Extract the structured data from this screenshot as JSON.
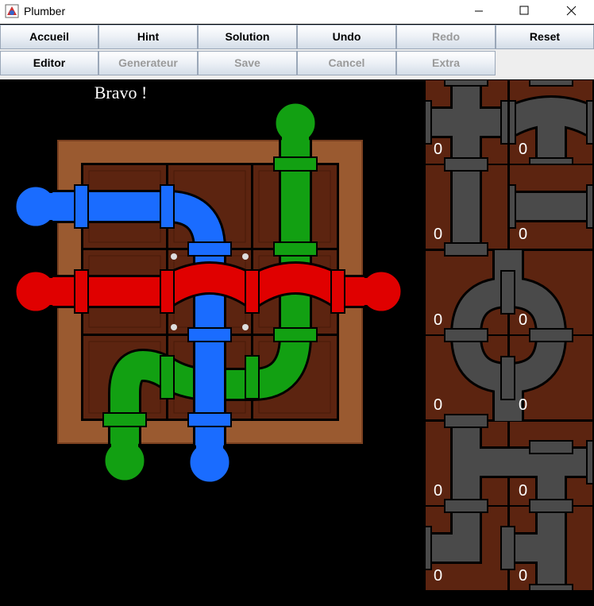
{
  "window": {
    "title": "Plumber",
    "controls": [
      "minimize",
      "maximize",
      "close"
    ]
  },
  "toolbar": {
    "row1": [
      {
        "label": "Accueil",
        "enabled": true
      },
      {
        "label": "Hint",
        "enabled": true
      },
      {
        "label": "Solution",
        "enabled": true
      },
      {
        "label": "Undo",
        "enabled": true
      },
      {
        "label": "Redo",
        "enabled": false
      },
      {
        "label": "Reset",
        "enabled": true
      }
    ],
    "row2": [
      {
        "label": "Editor",
        "enabled": true
      },
      {
        "label": "Generateur",
        "enabled": false
      },
      {
        "label": "Save",
        "enabled": false
      },
      {
        "label": "Cancel",
        "enabled": false
      },
      {
        "label": "Extra",
        "enabled": false
      }
    ]
  },
  "game": {
    "message": "Bravo !",
    "board": {
      "rows": 3,
      "cols": 3
    },
    "pipe_colors": {
      "blue": "#1a6cff",
      "red": "#e00000",
      "green": "#12a012",
      "gray": "#4a4a4a",
      "tile": "#5c2410",
      "frame": "#9a5a30"
    },
    "pieces_panel": {
      "counts": [
        "0",
        "0",
        "0",
        "0",
        "0",
        "0",
        "0",
        "0",
        "0",
        "0",
        "0",
        "0"
      ]
    }
  }
}
